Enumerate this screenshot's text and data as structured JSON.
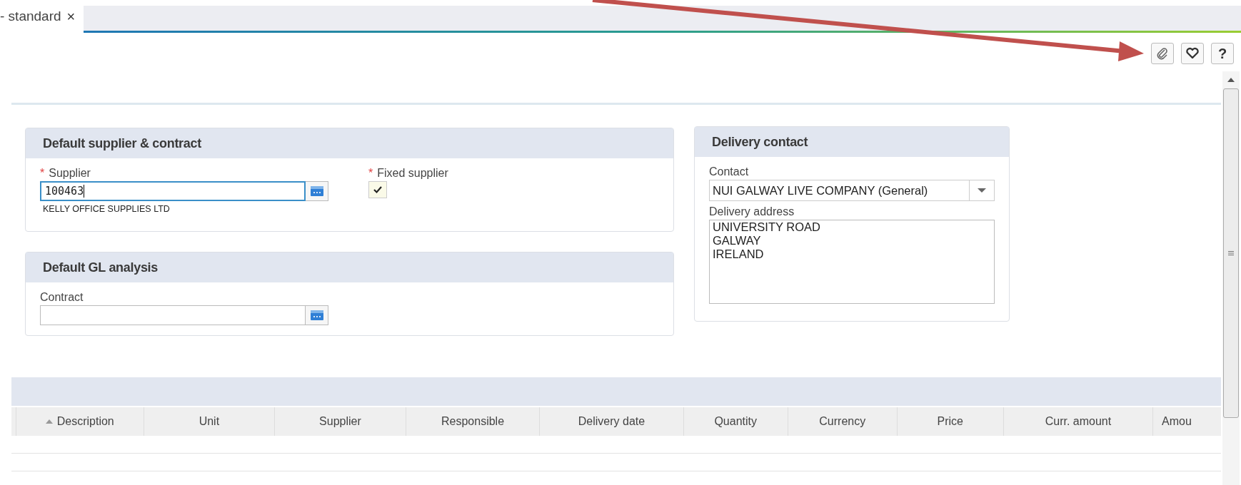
{
  "tabs": [
    {
      "label": "- standard",
      "close": "×"
    }
  ],
  "toolbar": {
    "buttons": [
      {
        "kind": "attach"
      },
      {
        "kind": "favorite"
      },
      {
        "kind": "help",
        "label": "?"
      }
    ]
  },
  "supplier_card": {
    "title": "Default supplier & contract",
    "supplier": {
      "label": "Supplier",
      "required_mark": "*",
      "value": "100463",
      "focused": true,
      "name": "KELLY OFFICE SUPPLIES LTD"
    },
    "fixed_supplier": {
      "label": "Fixed supplier",
      "required_mark": "*",
      "checked": true
    }
  },
  "gl_card": {
    "title": "Default GL analysis",
    "contract": {
      "label": "Contract"
    }
  },
  "delivery_card": {
    "title": "Delivery contact",
    "contact": {
      "label": "Contact",
      "value": "NUI GALWAY LIVE COMPANY (General)"
    },
    "address": {
      "label": "Delivery address",
      "lines": [
        "UNIVERSITY ROAD",
        "GALWAY",
        "IRELAND"
      ]
    }
  },
  "table": {
    "columns": [
      {
        "label": "Description",
        "sorted": true
      },
      {
        "label": "Unit",
        "sorted": false
      },
      {
        "label": "Supplier",
        "sorted": false
      },
      {
        "label": "Responsible",
        "sorted": false
      },
      {
        "label": "Delivery date",
        "sorted": false
      },
      {
        "label": "Quantity",
        "sorted": false
      },
      {
        "label": "Currency",
        "sorted": false
      },
      {
        "label": "Price",
        "sorted": false
      },
      {
        "label": "Curr. amount",
        "sorted": false
      },
      {
        "label": "Amou",
        "sorted": false
      }
    ]
  }
}
